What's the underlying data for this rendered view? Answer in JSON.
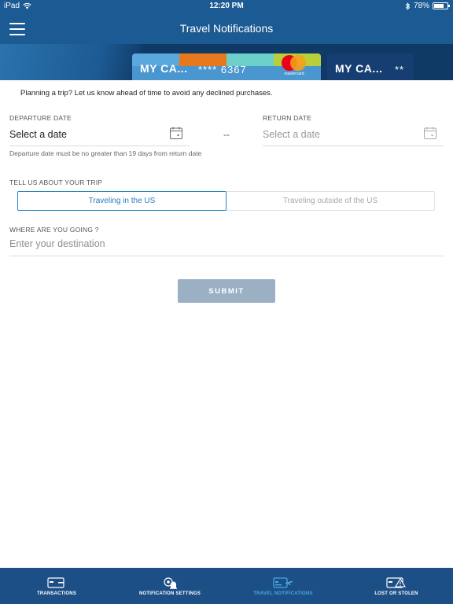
{
  "status_bar": {
    "device": "iPad",
    "time": "12:20 PM",
    "battery": "78%",
    "battery_level": 0.78
  },
  "nav": {
    "title": "Travel Notifications"
  },
  "cards": [
    {
      "name": "MY CA...",
      "number": "**** 6367",
      "brand": "mastercard"
    },
    {
      "name": "MY CA...",
      "number": "**"
    }
  ],
  "form": {
    "intro": "Planning a trip? Let us know ahead of time to avoid any declined purchases.",
    "departure_label": "DEPARTURE DATE",
    "departure_value": "Select a date",
    "separator": "--",
    "return_label": "RETURN DATE",
    "return_value": "Select a date",
    "departure_hint": "Departure date must be no greater than 19 days from return date",
    "trip_label": "TELL US ABOUT YOUR TRIP",
    "trip_options": [
      "Traveling in the US",
      "Traveling outside of the US"
    ],
    "trip_selected": 0,
    "destination_label": "WHERE ARE YOU GOING ?",
    "destination_placeholder": "Enter your destination",
    "submit_label": "SUBMIT"
  },
  "tabs": [
    {
      "label": "TRANSACTIONS",
      "icon": "card-icon",
      "active": false
    },
    {
      "label": "NOTIFICATION SETTINGS",
      "icon": "gear-bell-icon",
      "active": false
    },
    {
      "label": "TRAVEL NOTIFICATIONS",
      "icon": "card-plane-icon",
      "active": true
    },
    {
      "label": "LOST OR STOLEN",
      "icon": "card-alert-icon",
      "active": false
    }
  ],
  "colors": {
    "primary": "#1c5a93",
    "tab_bar": "#1c4f86",
    "active_tab": "#4aa8ea",
    "segment_active": "#2a85c9",
    "submit_disabled": "#9cb0c4"
  }
}
